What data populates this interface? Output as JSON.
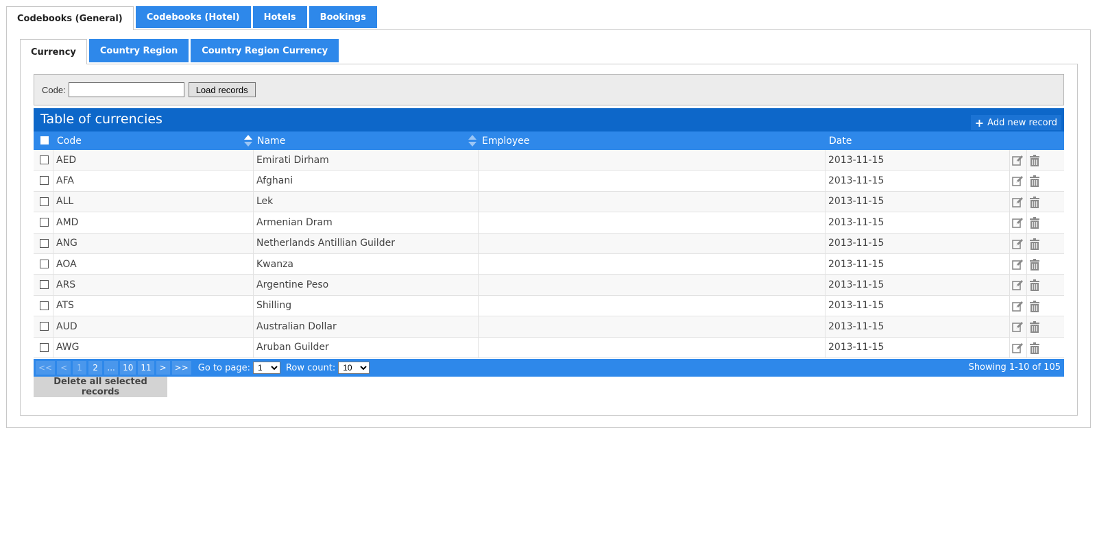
{
  "outer_tabs": [
    {
      "label": "Codebooks (General)",
      "active": true
    },
    {
      "label": "Codebooks (Hotel)",
      "active": false
    },
    {
      "label": "Hotels",
      "active": false
    },
    {
      "label": "Bookings",
      "active": false
    }
  ],
  "inner_tabs": [
    {
      "label": "Currency",
      "active": true
    },
    {
      "label": "Country Region",
      "active": false
    },
    {
      "label": "Country Region Currency",
      "active": false
    }
  ],
  "filter": {
    "code_label": "Code:",
    "code_value": "",
    "load_button": "Load records"
  },
  "table": {
    "title": "Table of currencies",
    "add_button": "Add new record",
    "columns": {
      "code": "Code",
      "name": "Name",
      "employee": "Employee",
      "date": "Date"
    },
    "rows": [
      {
        "code": "AED",
        "name": "Emirati Dirham",
        "employee": "",
        "date": "2013-11-15"
      },
      {
        "code": "AFA",
        "name": "Afghani",
        "employee": "",
        "date": "2013-11-15"
      },
      {
        "code": "ALL",
        "name": "Lek",
        "employee": "",
        "date": "2013-11-15"
      },
      {
        "code": "AMD",
        "name": "Armenian Dram",
        "employee": "",
        "date": "2013-11-15"
      },
      {
        "code": "ANG",
        "name": "Netherlands Antillian Guilder",
        "employee": "",
        "date": "2013-11-15"
      },
      {
        "code": "AOA",
        "name": "Kwanza",
        "employee": "",
        "date": "2013-11-15"
      },
      {
        "code": "ARS",
        "name": "Argentine Peso",
        "employee": "",
        "date": "2013-11-15"
      },
      {
        "code": "ATS",
        "name": "Shilling",
        "employee": "",
        "date": "2013-11-15"
      },
      {
        "code": "AUD",
        "name": "Australian Dollar",
        "employee": "",
        "date": "2013-11-15"
      },
      {
        "code": "AWG",
        "name": "Aruban Guilder",
        "employee": "",
        "date": "2013-11-15"
      }
    ]
  },
  "pager": {
    "buttons": [
      {
        "label": "<<",
        "disabled": true
      },
      {
        "label": "<",
        "disabled": true
      },
      {
        "label": "1",
        "disabled": true
      },
      {
        "label": "2",
        "disabled": false
      },
      {
        "label": "...",
        "disabled": false
      },
      {
        "label": "10",
        "disabled": false
      },
      {
        "label": "11",
        "disabled": false
      },
      {
        "label": ">",
        "disabled": false
      },
      {
        "label": ">>",
        "disabled": false
      }
    ],
    "goto_label": "Go to page:",
    "goto_value": "1",
    "rowcount_label": "Row count:",
    "rowcount_value": "10",
    "showing": "Showing 1-10 of 105"
  },
  "delete_all_button": "Delete all selected records",
  "colors": {
    "tab_blue": "#2e88ea",
    "title_bar_blue": "#0d67c9",
    "icon_gray": "#8a8a8a"
  }
}
